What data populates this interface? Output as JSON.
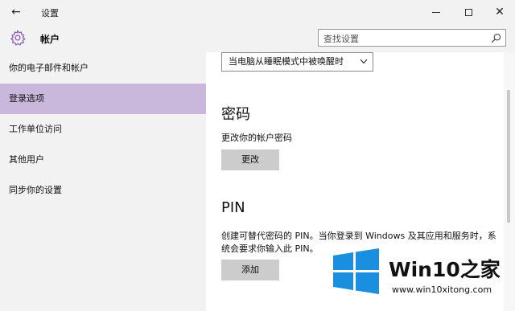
{
  "window": {
    "title": "设置",
    "back_glyph": "←",
    "close_glyph": "✕"
  },
  "header": {
    "title": "帐户",
    "search_placeholder": "查找设置"
  },
  "sidebar": {
    "items": [
      {
        "label": "你的电子邮件和帐户",
        "selected": false
      },
      {
        "label": "登录选项",
        "selected": true
      },
      {
        "label": "工作单位访问",
        "selected": false
      },
      {
        "label": "其他用户",
        "selected": false
      },
      {
        "label": "同步你的设置",
        "selected": false
      }
    ],
    "selected_color": "#c9b8db"
  },
  "content": {
    "wake_dropdown": {
      "value": "当电脑从睡眠模式中被唤醒时"
    },
    "password": {
      "title": "密码",
      "description": "更改你的帐户密码",
      "button_label": "更改"
    },
    "pin": {
      "title": "PIN",
      "description": "创建可替代密码的 PIN。当你登录到 Windows 及其应用和服务时，系统会要求你输入此 PIN。",
      "button_label": "添加"
    }
  },
  "watermark": {
    "brand": "Win10之家",
    "url": "www.win10xitong.com",
    "logo_color": "#1a8fe0"
  },
  "icons": {
    "gear": "gear-icon",
    "search": "search-icon",
    "back": "back-arrow-icon",
    "chevron": "chevron-down-icon"
  }
}
